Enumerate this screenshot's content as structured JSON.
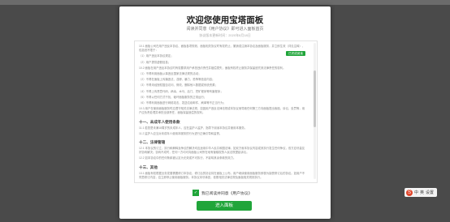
{
  "modal": {
    "title": "欢迎您使用宝塔面板",
    "subtitle": "阅读并同意《用户协议》即可进入面板首页",
    "date": "协议版本更新时间：2020年8月18日",
    "highlight_badge": "已完成阅读",
    "agreement_paragraphs_top": [
      "10.1 面板公司在用户违反本协议、面板各项规则、面板相关协议时有权终止、撤销或注销本协议及面板服务，并立即生效（详见注释），包括但不限于：",
      "（1）用户违反本协议规定；",
      "（2）用户提供虚假信息；",
      "10.2 面板在用户违反本协议时有权要求用户承担违约责任并赔偿损失，面板有权终止服务并保留追究其法律责任的权利。",
      "（1）不得利用面板从事违反国家法律法规的活动；",
      "（2）不得在面板上传播违法、淫秽、暴力、恐怖等信息内容；",
      "（3）不得未经授权擅自访问、修改、删除他人数据或系统资源；",
      "（4）不得上传恶意代码、病毒、木马、后门、挖矿程序等有害程序；",
      "（5）不得以任何方式干扰、破坏面板服务的正常运行；",
      "（6）不得利用面板进行网络攻击、发送垃圾邮件、刷单等不正当行为；",
      "10.3 用户在使用面板服务时应遵守相关法律法规，如因用户违反法律法规或本协议而导致任何第三方向面板提出索赔、诉讼、处罚等，用户应负责处理并承担全部责任，面板保留追偿的权利。"
    ],
    "section_11_title": "十一、未成年人使用条款",
    "section_11_paragraphs": [
      "11.1 若您是未满18周岁的未成年人，应在监护人监护、指导下阅读本协议并使用本服务。",
      "11.2 监护人应当对未成年人使用本服务的行为进行正确引导和监督。"
    ],
    "section_12_title": "十二、法律管辖",
    "section_12_paragraphs": [
      "12.1 本协议的订立、执行和解释及争议的解决均应适用中华人民共和国法律。如双方就本协议内容或其执行发生任何争议，双方应尽量友好协商解决；协商不成时，任何一方均可向面板公司所在地有管辖权的人民法院提起诉讼。",
      "12.2 如本协议中的任何条款被认定为无效或不可执行，不影响其余条款的效力。"
    ],
    "section_13_title": "十三、其他",
    "section_13_paragraphs": [
      "13.1 面板有权根据业务发展需要修订本协议，修订后的协议将在面板上公布，用户继续使用面板服务即视为接受修订后的协议。如用户不同意修订内容，应立即停止使用面板服务。本协议未尽事宜，依照相关法律法规及面板相关规则执行。"
    ],
    "agree_label": "我已阅读并同意《用户协议》",
    "enter_button": "进入面板"
  },
  "tray": {
    "items": [
      "中",
      "英",
      "设置"
    ]
  },
  "colors": {
    "accent": "#20a53a",
    "backdrop": "#4a4a4a"
  }
}
